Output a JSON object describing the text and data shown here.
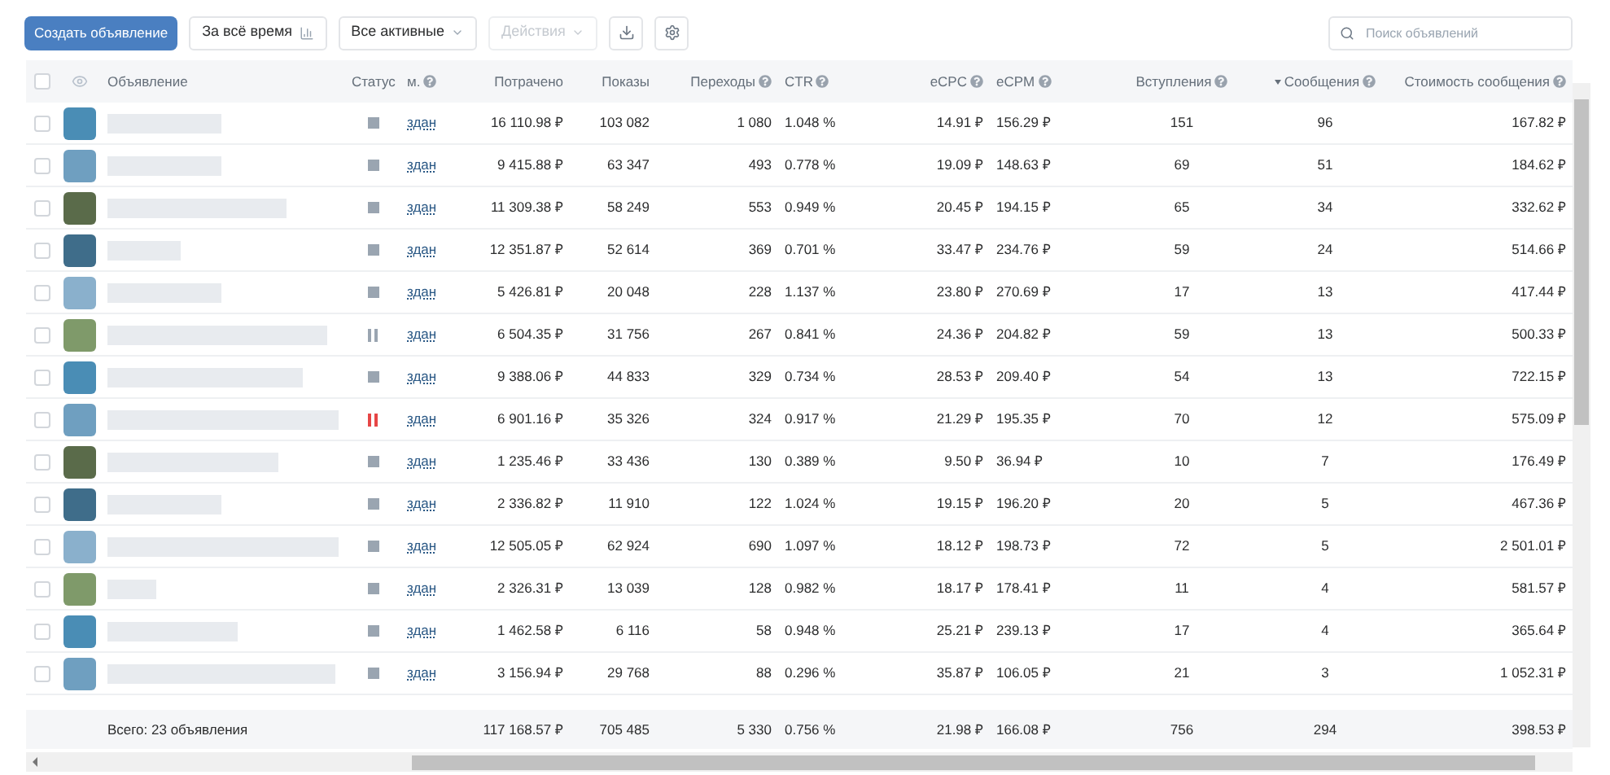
{
  "toolbar": {
    "create_button": "Создать объявление",
    "period_button": "За всё время",
    "filter_dropdown": "Все активные",
    "actions_dropdown": {
      "label": "Действия",
      "disabled": true
    },
    "search": {
      "placeholder": "Поиск объявлений"
    }
  },
  "table": {
    "select_all": {
      "checked": false
    },
    "columns": [
      {
        "label": "Объявление",
        "help": false,
        "sorted": false
      },
      {
        "label": "Статус",
        "help": false,
        "sorted": false
      },
      {
        "label": "м.",
        "help": true,
        "sorted": false
      },
      {
        "label": "Потрачено",
        "help": false,
        "sorted": false
      },
      {
        "label": "Показы",
        "help": false,
        "sorted": false
      },
      {
        "label": "Переходы",
        "help": true,
        "sorted": false
      },
      {
        "label": "CTR",
        "help": true,
        "sorted": false
      },
      {
        "label": "eCPC",
        "help": true,
        "sorted": false
      },
      {
        "label": "eCPM",
        "help": true,
        "sorted": false
      },
      {
        "label": "Вступления",
        "help": true,
        "sorted": false
      },
      {
        "label": "Сообщения",
        "help": true,
        "sorted": true
      },
      {
        "label": "Стоимость сообщения",
        "help": true,
        "sorted": false
      }
    ],
    "rows": [
      {
        "checked": false,
        "paused": false,
        "alert": false,
        "cells": [
          "",
          "",
          "здан",
          "16 110.98 ₽",
          "103 082",
          "1 080",
          "1.048 %",
          "14.91 ₽",
          "156.29 ₽",
          "151",
          "96",
          "167.82 ₽"
        ]
      },
      {
        "checked": false,
        "paused": false,
        "alert": false,
        "cells": [
          "",
          "",
          "здан",
          "9 415.88 ₽",
          "63 347",
          "493",
          "0.778 %",
          "19.09 ₽",
          "148.63 ₽",
          "69",
          "51",
          "184.62 ₽"
        ]
      },
      {
        "checked": false,
        "paused": false,
        "alert": false,
        "cells": [
          "",
          "",
          "здан",
          "11 309.38 ₽",
          "58 249",
          "553",
          "0.949 %",
          "20.45 ₽",
          "194.15 ₽",
          "65",
          "34",
          "332.62 ₽"
        ]
      },
      {
        "checked": false,
        "paused": false,
        "alert": false,
        "cells": [
          "",
          "",
          "здан",
          "12 351.87 ₽",
          "52 614",
          "369",
          "0.701 %",
          "33.47 ₽",
          "234.76 ₽",
          "59",
          "24",
          "514.66 ₽"
        ]
      },
      {
        "checked": false,
        "paused": false,
        "alert": false,
        "cells": [
          "",
          "",
          "здан",
          "5 426.81 ₽",
          "20 048",
          "228",
          "1.137 %",
          "23.80 ₽",
          "270.69 ₽",
          "17",
          "13",
          "417.44 ₽"
        ]
      },
      {
        "checked": false,
        "paused": true,
        "alert": false,
        "cells": [
          "",
          "",
          "здан",
          "6 504.35 ₽",
          "31 756",
          "267",
          "0.841 %",
          "24.36 ₽",
          "204.82 ₽",
          "59",
          "13",
          "500.33 ₽"
        ]
      },
      {
        "checked": false,
        "paused": false,
        "alert": false,
        "cells": [
          "",
          "",
          "здан",
          "9 388.06 ₽",
          "44 833",
          "329",
          "0.734 %",
          "28.53 ₽",
          "209.40 ₽",
          "54",
          "13",
          "722.15 ₽"
        ]
      },
      {
        "checked": false,
        "paused": true,
        "alert": true,
        "cells": [
          "",
          "",
          "здан",
          "6 901.16 ₽",
          "35 326",
          "324",
          "0.917 %",
          "21.29 ₽",
          "195.35 ₽",
          "70",
          "12",
          "575.09 ₽"
        ]
      },
      {
        "checked": false,
        "paused": false,
        "alert": false,
        "cells": [
          "",
          "",
          "здан",
          "1 235.46 ₽",
          "33 436",
          "130",
          "0.389 %",
          "9.50 ₽",
          "36.94 ₽",
          "10",
          "7",
          "176.49 ₽"
        ]
      },
      {
        "checked": false,
        "paused": false,
        "alert": false,
        "cells": [
          "",
          "",
          "здан",
          "2 336.82 ₽",
          "11 910",
          "122",
          "1.024 %",
          "19.15 ₽",
          "196.20 ₽",
          "20",
          "5",
          "467.36 ₽"
        ]
      },
      {
        "checked": false,
        "paused": false,
        "alert": false,
        "cells": [
          "",
          "",
          "здан",
          "12 505.05 ₽",
          "62 924",
          "690",
          "1.097 %",
          "18.12 ₽",
          "198.73 ₽",
          "72",
          "5",
          "2 501.01 ₽"
        ]
      },
      {
        "checked": false,
        "paused": false,
        "alert": false,
        "cells": [
          "",
          "",
          "здан",
          "2 326.31 ₽",
          "13 039",
          "128",
          "0.982 %",
          "18.17 ₽",
          "178.41 ₽",
          "11",
          "4",
          "581.57 ₽"
        ]
      },
      {
        "checked": false,
        "paused": false,
        "alert": false,
        "cells": [
          "",
          "",
          "здан",
          "1 462.58 ₽",
          "6 116",
          "58",
          "0.948 %",
          "25.21 ₽",
          "239.13 ₽",
          "17",
          "4",
          "365.64 ₽"
        ]
      },
      {
        "checked": false,
        "paused": false,
        "alert": false,
        "cells": [
          "",
          "",
          "здан",
          "3 156.94 ₽",
          "29 768",
          "88",
          "0.296 %",
          "35.87 ₽",
          "106.05 ₽",
          "21",
          "3",
          "1 052.31 ₽"
        ]
      }
    ],
    "totals": {
      "cells": [
        "Всего: 23 объявления",
        "",
        "",
        "117 168.57 ₽",
        "705 485",
        "5 330",
        "0.756 %",
        "21.98 ₽",
        "166.08 ₽",
        "756",
        "294",
        "398.53 ₽"
      ]
    }
  }
}
